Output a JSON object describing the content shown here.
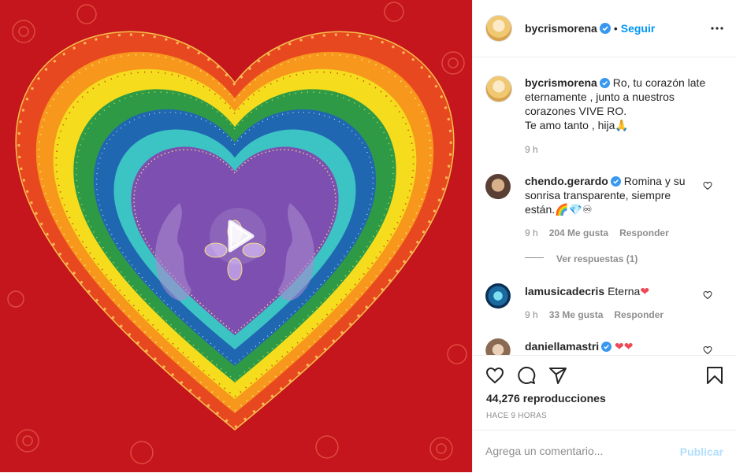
{
  "post": {
    "media_type": "video",
    "play_icon": "play-icon",
    "author": "bycrismorena",
    "follow_label": "Seguir",
    "dot": "•",
    "caption_lines": [
      "Ro, tu corazón late",
      "eternamente , junto a nuestros",
      "corazones VIVE RO.",
      "Te amo tanto , hija"
    ],
    "caption_emoji": "🙏",
    "caption_time": "9 h",
    "views": "44,276 reproducciones",
    "posted_ago": "HACE 9 HORAS"
  },
  "comments": [
    {
      "user": "chendo.gerardo",
      "verified": true,
      "text_lines": [
        "Romina y su",
        "sonrisa transparente, siempre",
        "están."
      ],
      "emojis": [
        "🌈",
        "💎",
        "♾"
      ],
      "time": "9 h",
      "likes": "204 Me gusta",
      "reply": "Responder",
      "view_replies": "Ver respuestas (1)"
    },
    {
      "user": "lamusicadecris",
      "verified": false,
      "text_lines": [
        "Eterna"
      ],
      "emojis": [
        "❤"
      ],
      "time": "9 h",
      "likes": "33 Me gusta",
      "reply": "Responder"
    },
    {
      "user": "daniellamastri",
      "verified": true,
      "text_lines": [
        ""
      ],
      "emojis": [
        "❤",
        "❤"
      ]
    }
  ],
  "input": {
    "placeholder": "Agrega un comentario...",
    "publish_label": "Publicar"
  },
  "colors": {
    "accent": "#0095f6",
    "publish_disabled": "#b2dffc",
    "heart_red": "#ed4956",
    "media_background": "#c4161c"
  },
  "icons": [
    "more-options-icon",
    "verified-badge-icon",
    "like-icon",
    "comment-icon",
    "share-icon",
    "save-icon",
    "comment-like-icon"
  ]
}
